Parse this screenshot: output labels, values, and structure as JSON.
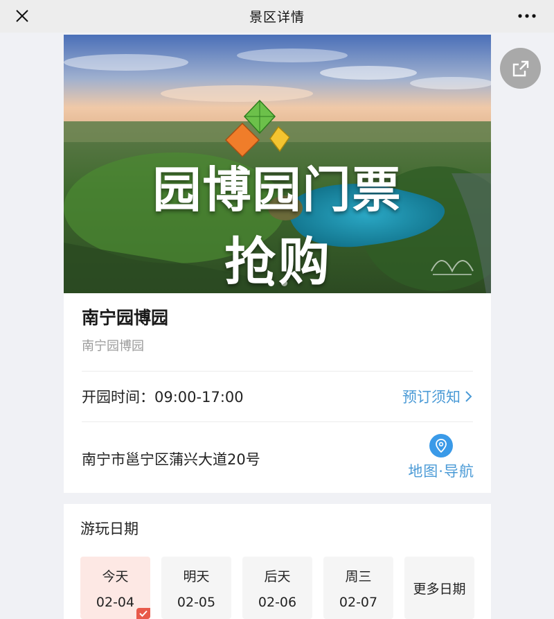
{
  "topbar": {
    "title": "景区详情",
    "close_icon": "close-icon",
    "more_icon": "more-dots-icon"
  },
  "hero": {
    "headline_line1": "园博园门票",
    "headline_line2": "抢购",
    "slide_count": 2,
    "active_slide": 1
  },
  "share": {
    "icon": "share-icon"
  },
  "attraction": {
    "name": "南宁园博园",
    "subname": "南宁园博园",
    "hours": "开园时间：09:00-17:00",
    "notice_label": "预订须知",
    "address": "南宁市邕宁区蒲兴大道20号",
    "map_label": "地图·导航"
  },
  "dates": {
    "title": "游玩日期",
    "options": [
      {
        "day": "今天",
        "date": "02-04",
        "selected": true
      },
      {
        "day": "明天",
        "date": "02-05",
        "selected": false
      },
      {
        "day": "后天",
        "date": "02-06",
        "selected": false
      },
      {
        "day": "周三",
        "date": "02-07",
        "selected": false
      }
    ],
    "more_label": "更多日期"
  },
  "colors": {
    "accent_blue": "#4a9ad6",
    "selected_bg": "#fde8e4",
    "check_red": "#e8594a"
  }
}
